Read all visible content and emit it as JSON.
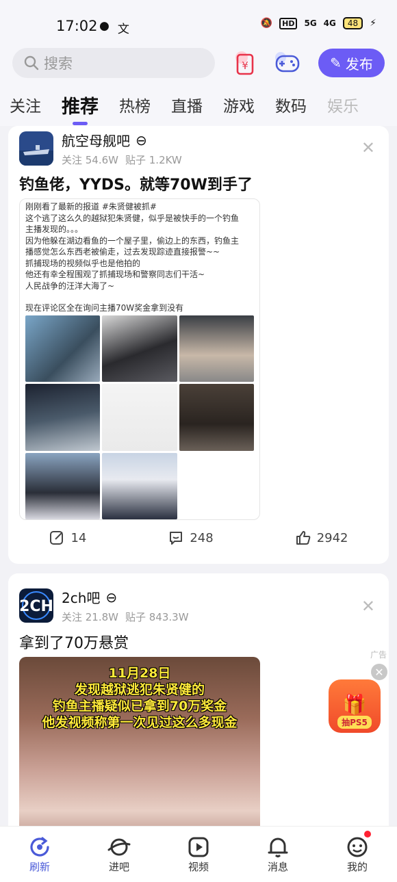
{
  "status": {
    "time": "17:02",
    "battery": "48",
    "network": "4G",
    "signal_label": "5G"
  },
  "topbar": {
    "search_placeholder": "搜索",
    "publish_label": "发布"
  },
  "tabs": [
    "关注",
    "推荐",
    "热榜",
    "直播",
    "游戏",
    "数码",
    "娱乐"
  ],
  "post1": {
    "forum": "航空母舰吧",
    "followers": "关注 54.6W",
    "posts": "贴子 1.2KW",
    "title": "钓鱼佬，YYDS。就等70W到手了",
    "screenshot_text": [
      "刚刚看了最新的报道 #朱贤健被抓#",
      "这个逃了这么久的越狱犯朱贤健，似乎是被快手的一个钓鱼",
      "主播发现的。。。",
      "因为他躲在湖边看鱼的一个屋子里，偷边上的东西，钓鱼主",
      "播感觉怎么东西老被偷走，过去发现踪迹直接报警~~",
      "抓捕现场的视频似乎也是他拍的",
      "他还有幸全程围观了抓捕现场和警察同志们干活~",
      "人民战争的汪洋大海了~",
      "",
      "现在评论区全在询问主播70W奖金拿到没有"
    ],
    "shares": "14",
    "comments": "248",
    "likes": "2942"
  },
  "post2": {
    "forum": "2ch吧",
    "followers": "关注 21.8W",
    "posts": "贴子 843.3W",
    "title": "拿到了70万悬赏",
    "video_caption": [
      "11月28日",
      "发现越狱逃犯朱贤健的",
      "钓鱼主播疑似已拿到70万奖金",
      "他发视频称第一次见过这么多现金"
    ]
  },
  "ad": {
    "label": "广告",
    "badge": "抽PS5"
  },
  "nav": [
    "刷新",
    "进吧",
    "视频",
    "消息",
    "我的"
  ],
  "colors": {
    "accent": "#6c5cf5",
    "tag": "#3a6bd9"
  }
}
